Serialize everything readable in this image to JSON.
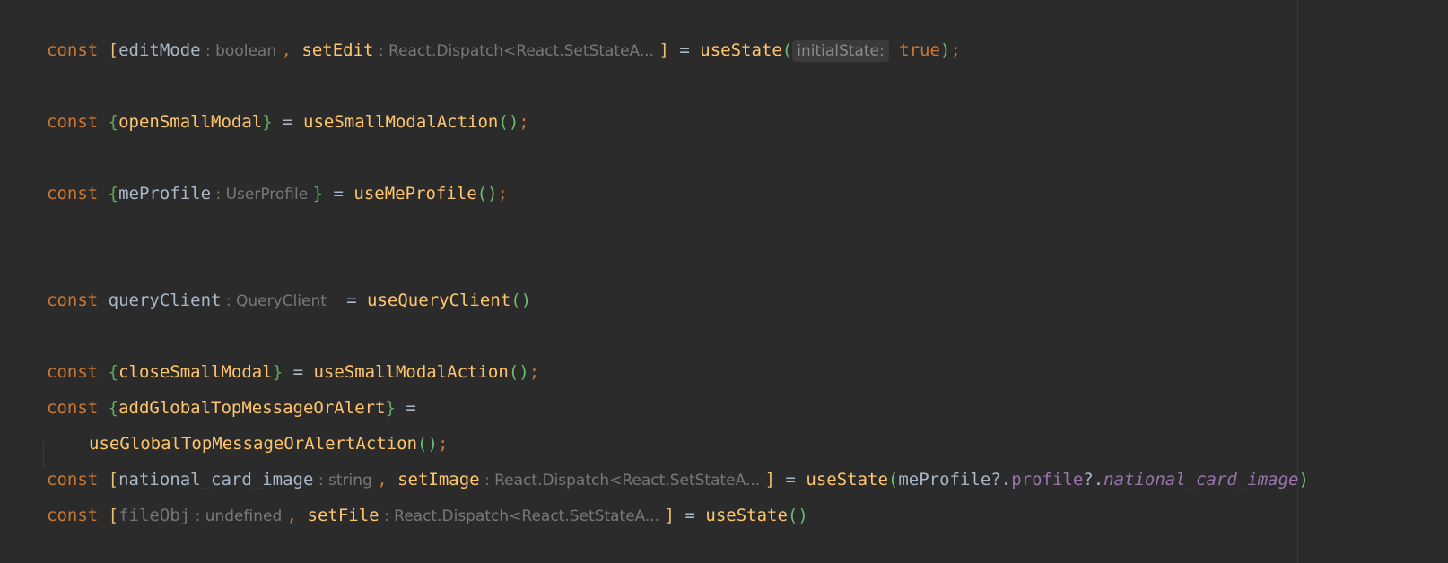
{
  "editor": {
    "colors": {
      "background": "#2b2b2b",
      "keyword": "#cc7832",
      "function": "#ffc66d",
      "variable": "#a9b7c6",
      "brace": "#5faa5f",
      "property": "#9876aa",
      "hint": "#787878"
    },
    "l1": {
      "kw": "const",
      "open": " [",
      "var1": "editMode",
      "hint1": " : boolean ",
      "comma": ", ",
      "var2": "setEdit",
      "hint2": " : React.Dispatch<React.SetStateA... ",
      "close": "]",
      "eq": " = ",
      "fn": "useState",
      "paren_open": "(",
      "param_hint": "initialState:",
      "val": " true",
      "paren_close": ")",
      "semi": ";"
    },
    "l2": {
      "kw": "const",
      "open": " {",
      "var1": "openSmallModal",
      "close": "}",
      "eq": " = ",
      "fn": "useSmallModalAction",
      "parens": "()",
      "semi": ";"
    },
    "l3": {
      "kw": "const",
      "open": " {",
      "var1": "meProfile",
      "hint1": " : UserProfile ",
      "close": "}",
      "eq": " = ",
      "fn": "useMeProfile",
      "parens": "()",
      "semi": ";"
    },
    "l4": {
      "kw": "const",
      "var1": " queryClient",
      "hint1": " : QueryClient  ",
      "eq": " = ",
      "fn": "useQueryClient",
      "parens": "()"
    },
    "l5": {
      "kw": "const",
      "open": " {",
      "var1": "closeSmallModal",
      "close": "}",
      "eq": " = ",
      "fn": "useSmallModalAction",
      "parens": "()",
      "semi": ";"
    },
    "l6": {
      "kw": "const",
      "open": " {",
      "var1": "addGlobalTopMessageOrAlert",
      "close": "}",
      "eq": " ="
    },
    "l7": {
      "fn": "useGlobalTopMessageOrAlertAction",
      "parens": "()",
      "semi": ";"
    },
    "l8": {
      "kw": "const",
      "open": " [",
      "var1": "national_card_image",
      "hint1": " : string ",
      "comma": ", ",
      "var2": "setImage",
      "hint2": " : React.Dispatch<React.SetStateA... ",
      "close": "]",
      "eq": " = ",
      "fn": "useState",
      "paren_open": "(",
      "arg1": "meProfile",
      "dot1": "?.",
      "prop1": "profile",
      "dot2": "?.",
      "prop2": "national_card_image",
      "paren_close": ")"
    },
    "l9": {
      "kw": "const",
      "open": " [",
      "var1": "fileObj",
      "hint1": " : undefined ",
      "comma": ", ",
      "var2": "setFile",
      "hint2": " : React.Dispatch<React.SetStateA... ",
      "close": "]",
      "eq": " = ",
      "fn": "useState",
      "parens": "()"
    }
  }
}
